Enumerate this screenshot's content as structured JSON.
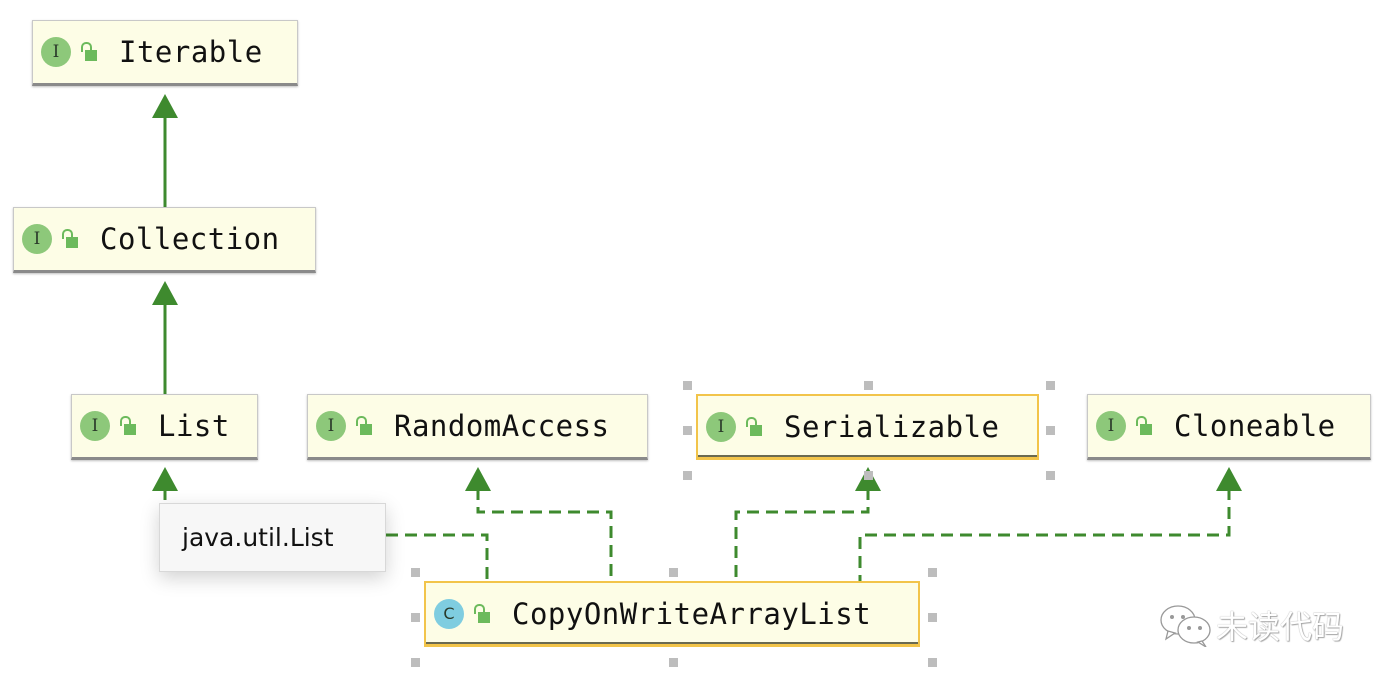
{
  "diagram": {
    "nodes": [
      {
        "id": "iterable",
        "kind": "interface",
        "badge": "I",
        "label": "Iterable"
      },
      {
        "id": "collection",
        "kind": "interface",
        "badge": "I",
        "label": "Collection"
      },
      {
        "id": "list",
        "kind": "interface",
        "badge": "I",
        "label": "List"
      },
      {
        "id": "randomaccess",
        "kind": "interface",
        "badge": "I",
        "label": "RandomAccess"
      },
      {
        "id": "serializable",
        "kind": "interface",
        "badge": "I",
        "label": "Serializable",
        "selected": true
      },
      {
        "id": "cloneable",
        "kind": "interface",
        "badge": "I",
        "label": "Cloneable"
      },
      {
        "id": "cowal",
        "kind": "class",
        "badge": "C",
        "label": "CopyOnWriteArrayList",
        "selected": true
      }
    ],
    "edges": [
      {
        "from": "collection",
        "to": "iterable",
        "type": "extends",
        "style": "solid"
      },
      {
        "from": "list",
        "to": "collection",
        "type": "extends",
        "style": "solid"
      },
      {
        "from": "cowal",
        "to": "list",
        "type": "implements",
        "style": "dashed"
      },
      {
        "from": "cowal",
        "to": "randomaccess",
        "type": "implements",
        "style": "dashed"
      },
      {
        "from": "cowal",
        "to": "serializable",
        "type": "implements",
        "style": "dashed"
      },
      {
        "from": "cowal",
        "to": "cloneable",
        "type": "implements",
        "style": "dashed"
      }
    ],
    "tooltip": "java.util.List",
    "colors": {
      "edge": "#3e8a2e",
      "node_fill": "#fdfde6",
      "selected_border": "#f2c44a",
      "interface_badge": "#8dc87a",
      "class_badge": "#7fcde0"
    }
  },
  "watermark": {
    "text": "未读代码",
    "icon": "wechat-icon"
  }
}
